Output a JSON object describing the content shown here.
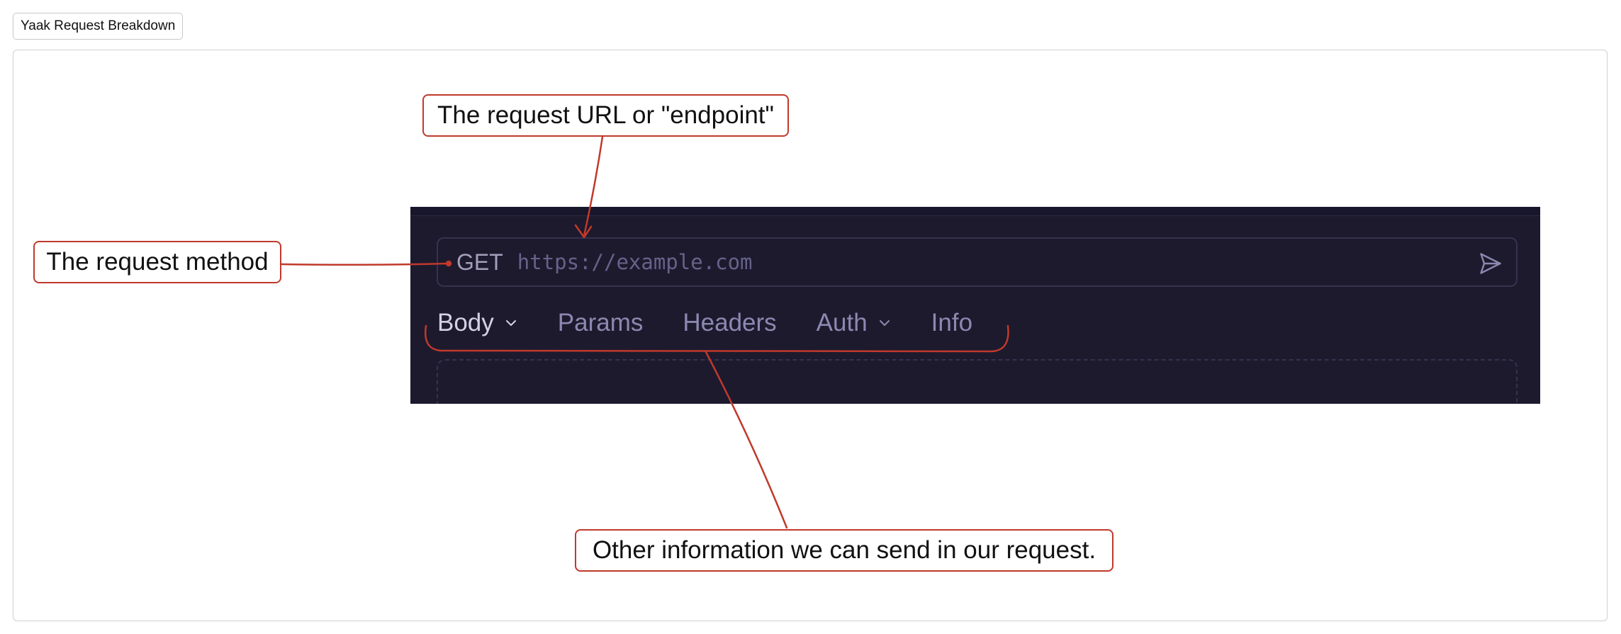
{
  "title_badge": "Yaak Request Breakdown",
  "request": {
    "method": "GET",
    "url_placeholder": "https://example.com"
  },
  "tabs": [
    {
      "label": "Body",
      "has_dropdown": true,
      "active": true
    },
    {
      "label": "Params",
      "has_dropdown": false,
      "active": false
    },
    {
      "label": "Headers",
      "has_dropdown": false,
      "active": false
    },
    {
      "label": "Auth",
      "has_dropdown": true,
      "active": false
    },
    {
      "label": "Info",
      "has_dropdown": false,
      "active": false
    }
  ],
  "annotations": {
    "url": "The request URL or \"endpoint\"",
    "method": "The request method",
    "tabs": "Other information we can send in our request."
  },
  "colors": {
    "annotation": "#c0392b",
    "app_background": "#1d1a2e",
    "tab_active": "#d4d1e6",
    "tab_inactive": "#8d88b0"
  },
  "icons": {
    "send": "send-icon",
    "dropdown": "chevron-down-icon"
  }
}
